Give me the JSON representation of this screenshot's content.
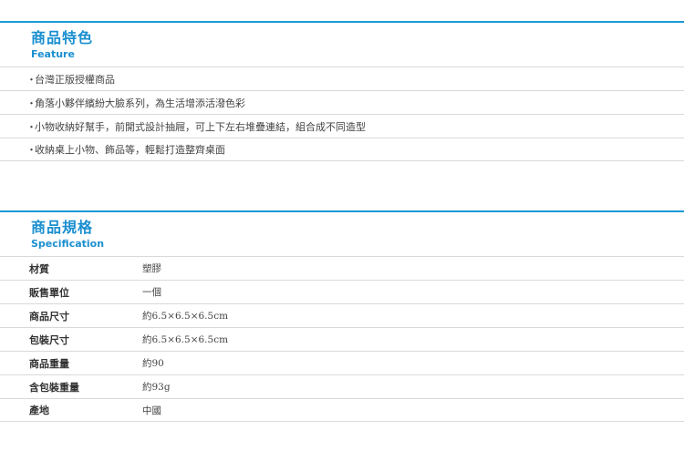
{
  "feature": {
    "title_zh": "商品特色",
    "title_en": "Feature",
    "bullet": "・",
    "items": [
      "台灣正版授權商品",
      "角落小夥伴繽紛大臉系列，為生活增添活潑色彩",
      "小物收納好幫手，前開式設計抽屜，可上下左右堆疊連結，組合成不同造型",
      "收納桌上小物、飾品等，輕鬆打造整齊桌面"
    ]
  },
  "spec": {
    "title_zh": "商品規格",
    "title_en": "Specification",
    "rows": [
      {
        "key": "材質",
        "value": "塑膠"
      },
      {
        "key": "販售單位",
        "value": "一個"
      },
      {
        "key": "商品尺寸",
        "value": "約6.5×6.5×6.5cm"
      },
      {
        "key": "包裝尺寸",
        "value": "約6.5×6.5×6.5cm"
      },
      {
        "key": "商品重量",
        "value": "約90"
      },
      {
        "key": "含包裝重量",
        "value": "約93g"
      },
      {
        "key": "產地",
        "value": "中國"
      }
    ]
  },
  "colors": {
    "accent": "#1a8fd0",
    "divider": "#d9d9d9"
  }
}
